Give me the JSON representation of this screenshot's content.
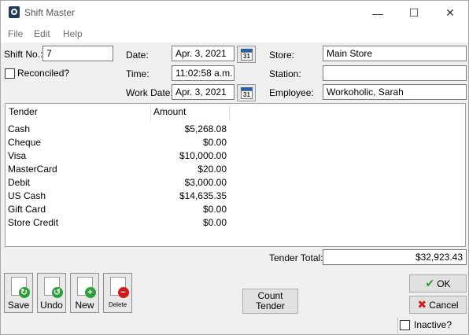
{
  "window": {
    "title": "Shift Master"
  },
  "titlebar_buttons": {
    "minimize": "—",
    "maximize": "☐",
    "close": "✕"
  },
  "menu": [
    "File",
    "Edit",
    "Help"
  ],
  "form": {
    "shift_no_label": "Shift No.:",
    "shift_no_value": "7",
    "reconciled_label": "Reconciled?",
    "date_label": "Date:",
    "date_value": "Apr. 3, 2021",
    "time_label": "Time:",
    "time_value": "11:02:58 a.m.",
    "work_date_label": "Work Date:",
    "work_date_value": "Apr. 3, 2021",
    "calendar_day": "31",
    "store_label": "Store:",
    "store_value": "Main Store",
    "station_label": "Station:",
    "station_value": "",
    "employee_label": "Employee:",
    "employee_value": "Workoholic, Sarah"
  },
  "grid": {
    "columns": [
      "Tender",
      "Amount"
    ],
    "rows": [
      {
        "tender": "Cash",
        "amount": "$5,268.08"
      },
      {
        "tender": "Cheque",
        "amount": "$0.00"
      },
      {
        "tender": "Visa",
        "amount": "$10,000.00"
      },
      {
        "tender": "MasterCard",
        "amount": "$20.00"
      },
      {
        "tender": "Debit",
        "amount": "$3,000.00"
      },
      {
        "tender": "US Cash",
        "amount": "$14,635.35"
      },
      {
        "tender": "Gift Card",
        "amount": "$0.00"
      },
      {
        "tender": "Store Credit",
        "amount": "$0.00"
      }
    ]
  },
  "tender_total": {
    "label": "Tender Total:",
    "value": "$32,923.43"
  },
  "buttons": {
    "save": "Save",
    "undo": "Undo",
    "new": "New",
    "delete": "Delete",
    "count_tender_line1": "Count",
    "count_tender_line2": "Tender",
    "ok": "OK",
    "cancel": "Cancel"
  },
  "inactive_label": "Inactive?",
  "colors": {
    "save_badge": "#2e9e3a",
    "undo_badge": "#2e9e3a",
    "new_badge": "#2e9e3a",
    "delete_badge": "#d11a1a",
    "ok_check": "#2a9d2a",
    "cancel_x": "#d12020"
  }
}
